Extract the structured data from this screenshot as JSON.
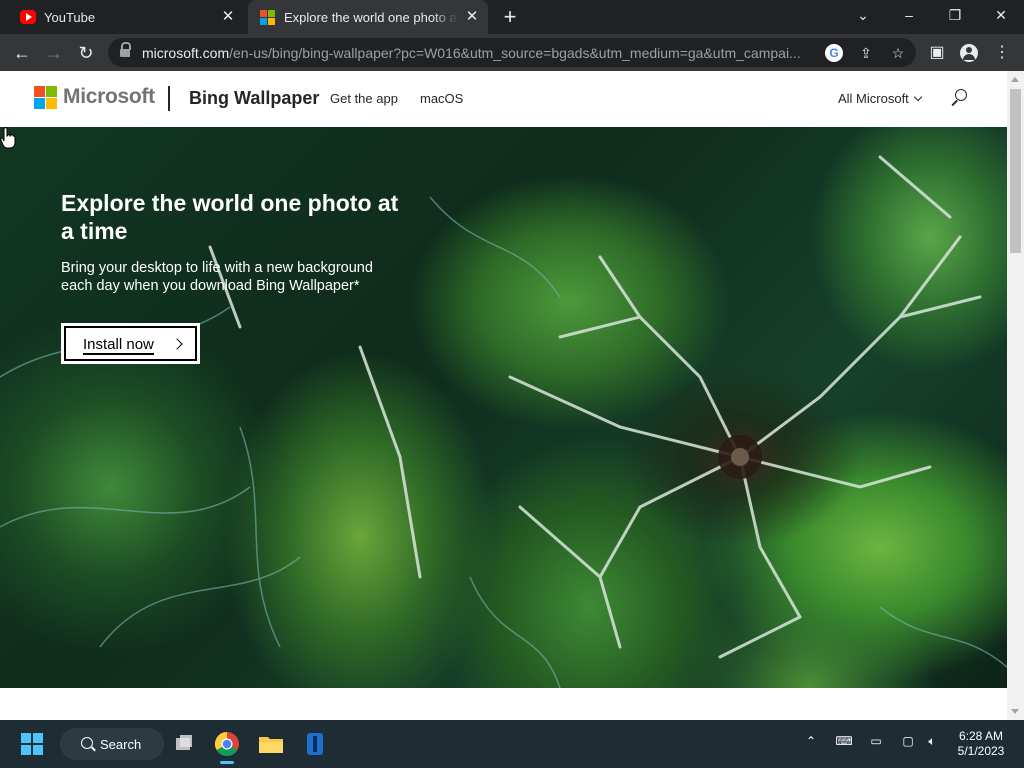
{
  "browser": {
    "tabs": [
      {
        "title": "YouTube",
        "active": false
      },
      {
        "title": "Explore the world one photo at a time",
        "active": true
      }
    ],
    "url_host": "microsoft.com",
    "url_rest": "/en-us/bing/bing-wallpaper?pc=W016&utm_source=bgads&utm_medium=ga&utm_campai..."
  },
  "site": {
    "brand": "Microsoft",
    "product": "Bing Wallpaper",
    "nav": [
      "Get the app",
      "macOS"
    ],
    "all_microsoft": "All Microsoft"
  },
  "hero": {
    "title": "Explore the world one photo at a time",
    "subtitle": "Bring your desktop to life with a new background each day when you download Bing Wallpaper*",
    "cta": "Install now"
  },
  "taskbar": {
    "search_label": "Search",
    "time": "6:28 AM",
    "date": "5/1/2023"
  },
  "colors": {
    "ms_red": "#f25022",
    "ms_green": "#7fba00",
    "ms_blue": "#00a4ef",
    "ms_yellow": "#ffb900",
    "accent": "#4cc2ff"
  }
}
